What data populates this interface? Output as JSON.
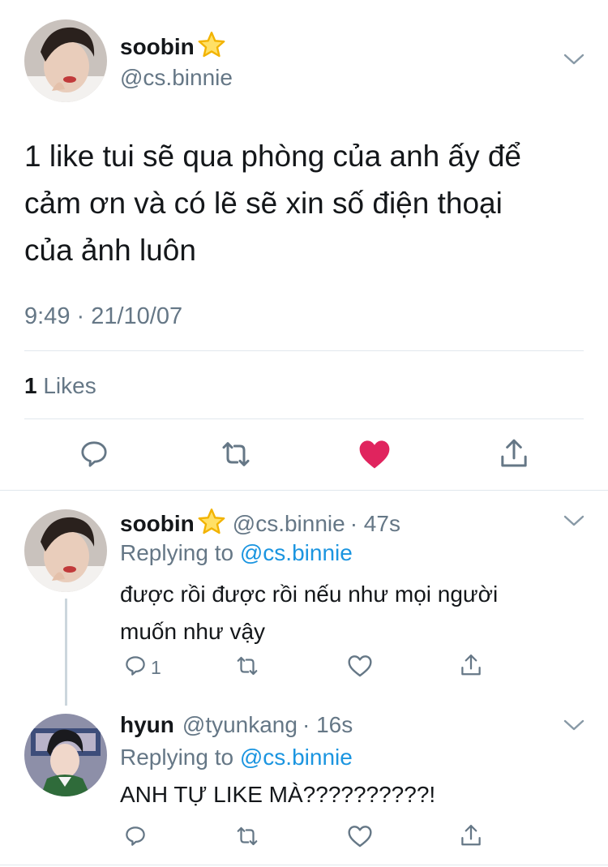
{
  "main_tweet": {
    "display_name": "soobin",
    "handle": "@cs.binnie",
    "text_line1": "1 like tui sẽ qua phòng của anh ấy để",
    "text_line2": "cảm ơn và có lẽ sẽ xin số điện thoại",
    "text_line3": "của ảnh luôn",
    "timestamp": "9:49 · 21/10/07",
    "likes_count": "1",
    "likes_label": "Likes"
  },
  "reply1": {
    "display_name": "soobin",
    "handle": "@cs.binnie",
    "time": "· 47s",
    "replying_prefix": "Replying to",
    "replying_handle": "@cs.binnie",
    "text_line1": "được rồi được rồi nếu như mọi người",
    "text_line2": "muốn như vậy",
    "reply_count": "1"
  },
  "reply2": {
    "display_name": "hyun",
    "handle": "@tyunkang",
    "time": "· 16s",
    "replying_prefix": "Replying to",
    "replying_handle": "@cs.binnie",
    "text": "ANH TỰ LIKE MÀ??????????!"
  },
  "colors": {
    "text": "#14171a",
    "secondary": "#657786",
    "link": "#1b95e0",
    "like_active": "#e0245e",
    "divider": "#e1e8ed"
  },
  "icons": [
    "star-emoji-icon",
    "chevron-down-icon",
    "reply-icon",
    "retweet-icon",
    "heart-icon",
    "share-icon"
  ]
}
